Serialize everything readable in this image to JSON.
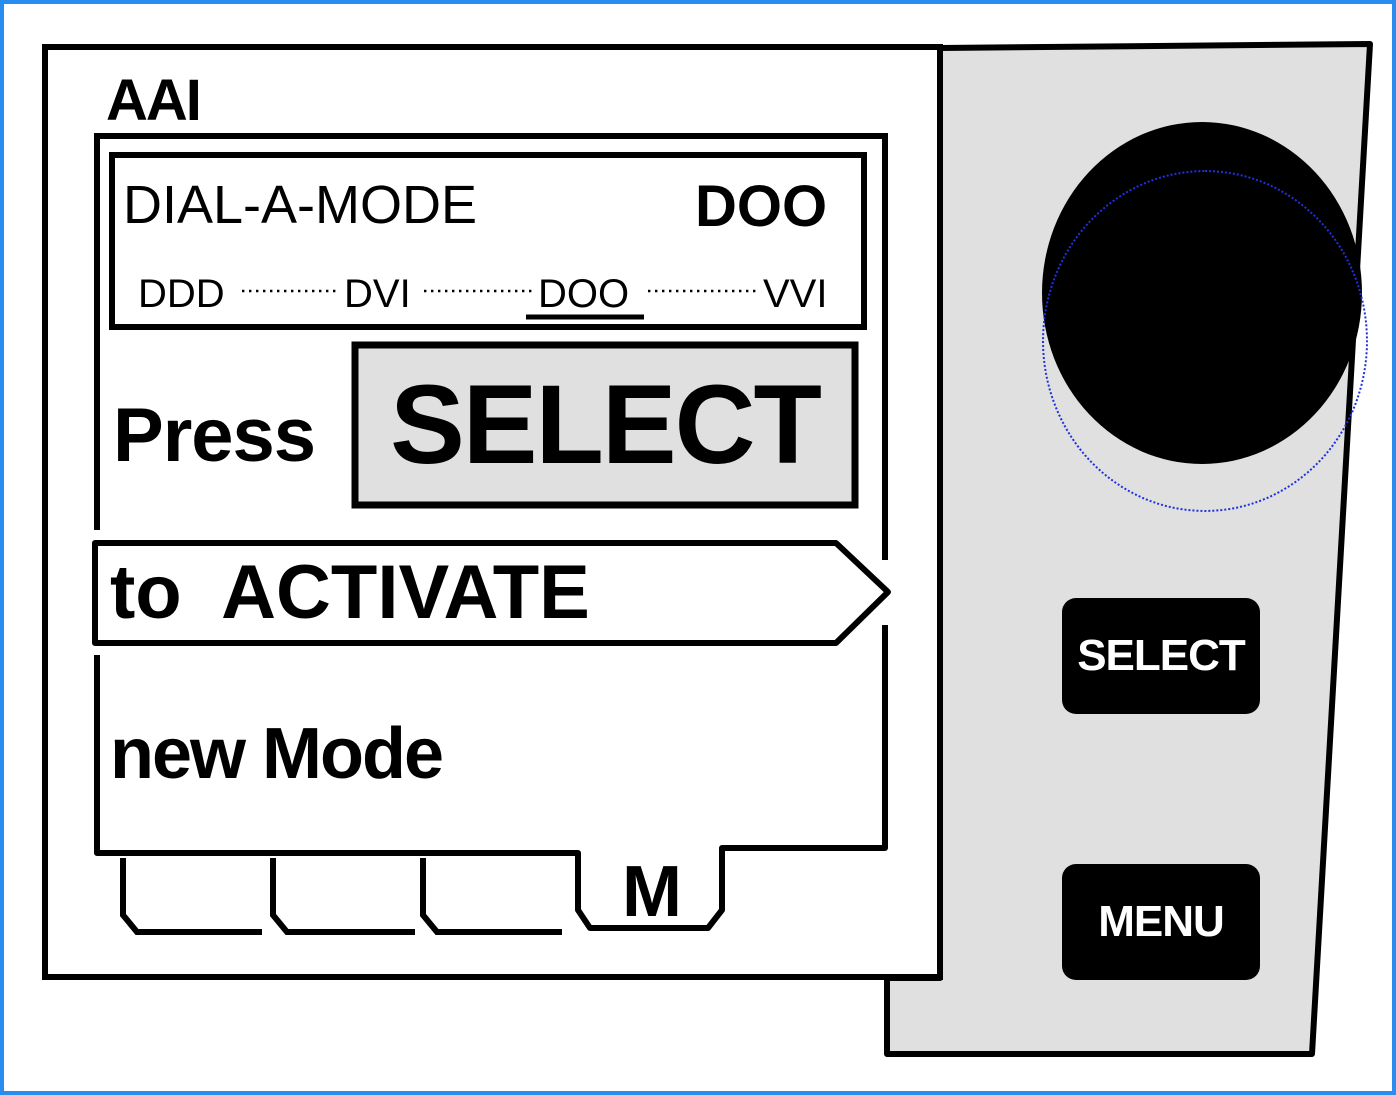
{
  "screen": {
    "mode_label": "AAI",
    "mode_box": {
      "title": "DIAL-A-MODE",
      "current_mode": "DOO",
      "options": [
        "DDD",
        "DVI",
        "DOO",
        "VVI"
      ],
      "selected_option": "DOO"
    },
    "instruction": {
      "press_label": "Press",
      "select_label": "SELECT",
      "activate_label": "to  ACTIVATE",
      "new_mode_label": "new Mode"
    },
    "tabs": [
      {
        "label": ""
      },
      {
        "label": ""
      },
      {
        "label": ""
      },
      {
        "label": "M"
      }
    ]
  },
  "controls": {
    "knob_icon": "rotary-knob-icon",
    "select_button": "SELECT",
    "menu_button": "MENU"
  },
  "colors": {
    "panel_gray": "#e0e0e0",
    "select_highlight": "#e0e0e0",
    "frame_blue": "#2a8cf0",
    "knob_ring_blue": "#2030e0"
  }
}
